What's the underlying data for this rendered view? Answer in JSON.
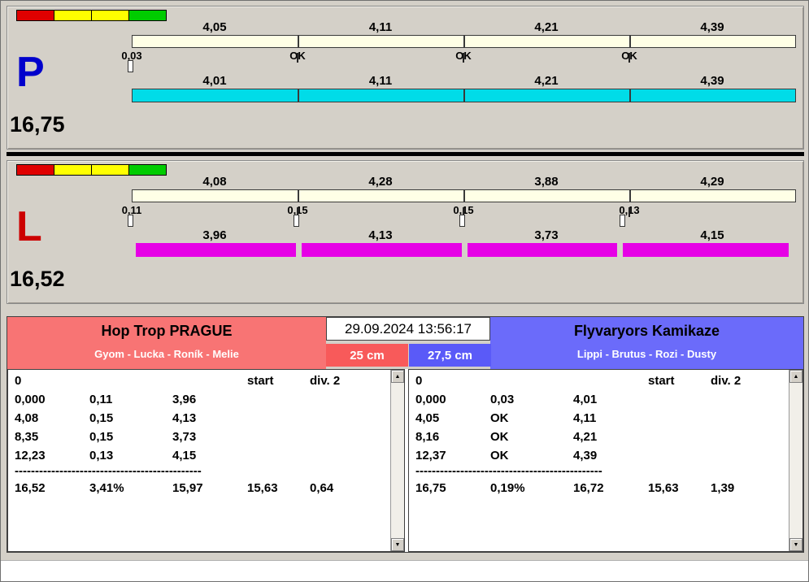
{
  "colors": {
    "window_bg": "#d4d0c8",
    "bar_top": "#ffffe6",
    "bar_cyan": "#00dce8",
    "bar_magenta": "#e600e6",
    "light_red": "#e00000",
    "light_yellow": "#ffff00",
    "light_green": "#00cc00",
    "team_left_header": "#f87474",
    "team_right_header": "#6b6bfa",
    "height_left_box": "#f85a5a",
    "height_right_box": "#5a5af8",
    "letter_p": "#0000cc",
    "letter_l": "#cc0000"
  },
  "panel_p": {
    "letter": "P",
    "total": "16,75",
    "lights": [
      "red",
      "yellow",
      "yellow",
      "green"
    ],
    "top_values": [
      "4,05",
      "4,11",
      "4,21",
      "4,39"
    ],
    "marks": [
      "0,03",
      "OK",
      "OK",
      "OK"
    ],
    "bottom_values": [
      "4,01",
      "4,11",
      "4,21",
      "4,39"
    ]
  },
  "panel_l": {
    "letter": "L",
    "total": "16,52",
    "lights": [
      "red",
      "yellow",
      "yellow",
      "green"
    ],
    "top_values": [
      "4,08",
      "4,28",
      "3,88",
      "4,29"
    ],
    "marks": [
      "0,11",
      "0,15",
      "0,15",
      "0,13"
    ],
    "bottom_values": [
      "3,96",
      "4,13",
      "3,73",
      "4,15"
    ]
  },
  "scoreboard": {
    "datetime": "29.09.2024 13:56:17",
    "left": {
      "team": "Hop Trop PRAGUE",
      "members": "Gyom - Lucka - Roník - Melie",
      "height": "25 cm",
      "header": {
        "zero": "0",
        "start": "start",
        "div": "div. 2"
      },
      "rows": [
        [
          "0,000",
          "0,11",
          "3,96"
        ],
        [
          "4,08",
          "0,15",
          "4,13"
        ],
        [
          "8,35",
          "0,15",
          "3,73"
        ],
        [
          "12,23",
          "0,13",
          "4,15"
        ]
      ],
      "dash": "----------------------------------------------",
      "summary": [
        "16,52",
        "3,41%",
        "15,97",
        "15,63",
        "0,64"
      ]
    },
    "right": {
      "team": "Flyvaryors Kamikaze",
      "members": "Lippi - Brutus - Rozi - Dusty",
      "height": "27,5 cm",
      "header": {
        "zero": "0",
        "start": "start",
        "div": "div. 2"
      },
      "rows": [
        [
          "0,000",
          "0,03",
          "4,01"
        ],
        [
          "4,05",
          "OK",
          "4,11"
        ],
        [
          "8,16",
          "OK",
          "4,21"
        ],
        [
          "12,37",
          "OK",
          "4,39"
        ]
      ],
      "dash": "----------------------------------------------",
      "summary": [
        "16,75",
        "0,19%",
        "16,72",
        "15,63",
        "1,39"
      ]
    }
  }
}
